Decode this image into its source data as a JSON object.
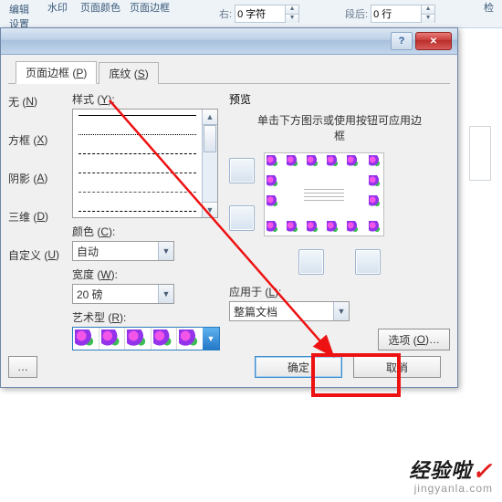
{
  "ribbon": {
    "group1_line1": "编辑",
    "group1_line2": "设置",
    "group2": "水印",
    "group3": "页面颜色",
    "group4": "页面边框",
    "indent_right_icon": "indent-right-icon",
    "indent_right_label": "右:",
    "indent_right_value": "0 字符",
    "spacing_after_icon": "spacing-after-icon",
    "spacing_after_label": "段后:",
    "spacing_after_value": "0 行",
    "group5": "检"
  },
  "dialog": {
    "help": "?",
    "close": "✕",
    "tabs": {
      "page_border_pre": "页面边框 (",
      "page_border_u": "P",
      "page_border_post": ")",
      "shading_pre": "底纹 (",
      "shading_u": "S",
      "shading_post": ")"
    },
    "left": {
      "none_pre": "无 (",
      "none_u": "N",
      "none_post": ")",
      "box_pre": "方框 (",
      "box_u": "X",
      "box_post": ")",
      "shadow_pre": "阴影 (",
      "shadow_u": "A",
      "shadow_post": ")",
      "threed_pre": "三维 (",
      "threed_u": "D",
      "threed_post": ")",
      "custom_pre": "自定义 (",
      "custom_u": "U",
      "custom_post": ")"
    },
    "style_label_pre": "样式 (",
    "style_label_u": "Y",
    "style_label_post": "):",
    "color_label_pre": "颜色 (",
    "color_label_u": "C",
    "color_label_post": "):",
    "color_value": "自动",
    "width_label_pre": "宽度 (",
    "width_label_u": "W",
    "width_label_post": "):",
    "width_value": "20 磅",
    "art_label_pre": "艺术型 (",
    "art_label_u": "R",
    "art_label_post": "):",
    "preview_label": "预览",
    "preview_hint": "单击下方图示或使用按钮可应用边框",
    "apply_label_pre": "应用于 (",
    "apply_label_u": "L",
    "apply_label_post": "):",
    "apply_value": "整篇文档",
    "options_pre": "选项 (",
    "options_u": "O",
    "options_post": ")…",
    "ok": "确定",
    "cancel": "取消"
  },
  "watermark": {
    "text": "经验啦",
    "check": "✓",
    "sub": "jingyanla.com"
  }
}
